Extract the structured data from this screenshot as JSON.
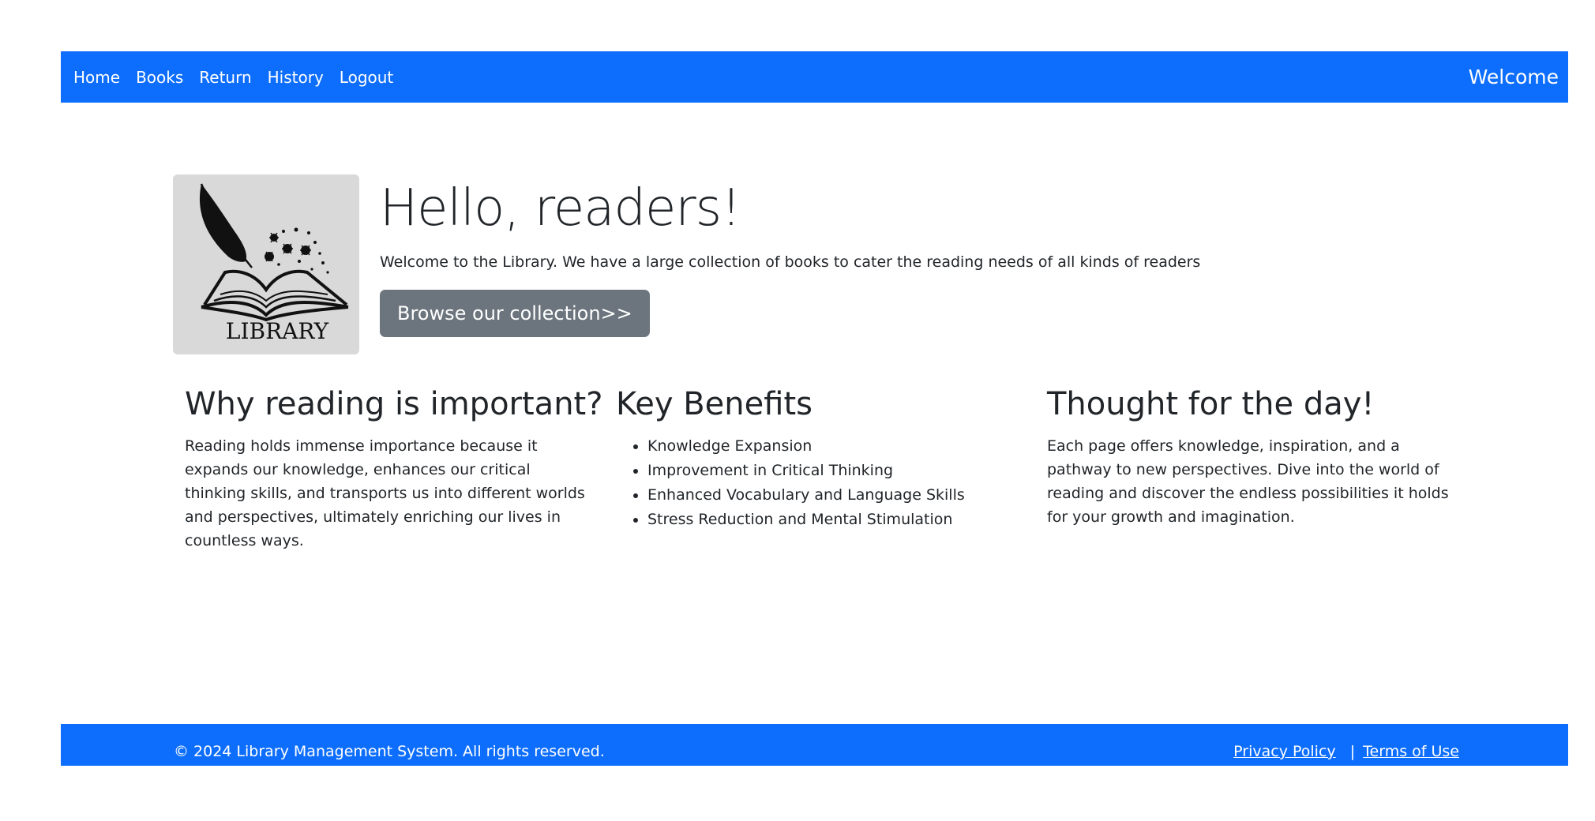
{
  "navbar": {
    "links": [
      "Home",
      "Books",
      "Return",
      "History",
      "Logout"
    ],
    "welcome": "Welcome",
    "color": "#0d6efd"
  },
  "hero": {
    "logo_text": "LIBRARY",
    "title": "Hello, readers!",
    "text": "Welcome to the Library. We have a large collection of books to cater the reading needs of all kinds of readers",
    "button_label": "Browse our collection>>",
    "button_color": "#6c757d"
  },
  "sections": [
    {
      "heading": "Why reading is important?",
      "text": "Reading holds immense importance because it expands our knowledge, enhances our critical thinking skills, and transports us into different worlds and perspectives, ultimately enriching our lives in countless ways."
    },
    {
      "heading": "Key Benefits",
      "items": [
        "Knowledge Expansion",
        "Improvement in Critical Thinking",
        "Enhanced Vocabulary and Language Skills",
        "Stress Reduction and Mental Stimulation"
      ]
    },
    {
      "heading": "Thought for the day!",
      "text": "Each page offers knowledge, inspiration, and a pathway to new perspectives. Dive into the world of reading and discover the endless possibilities it holds for your growth and imagination."
    }
  ],
  "footer": {
    "copyright": "© 2024 Library Management System. All rights reserved.",
    "privacy": "Privacy Policy",
    "separator": "|",
    "terms": "Terms of Use"
  }
}
